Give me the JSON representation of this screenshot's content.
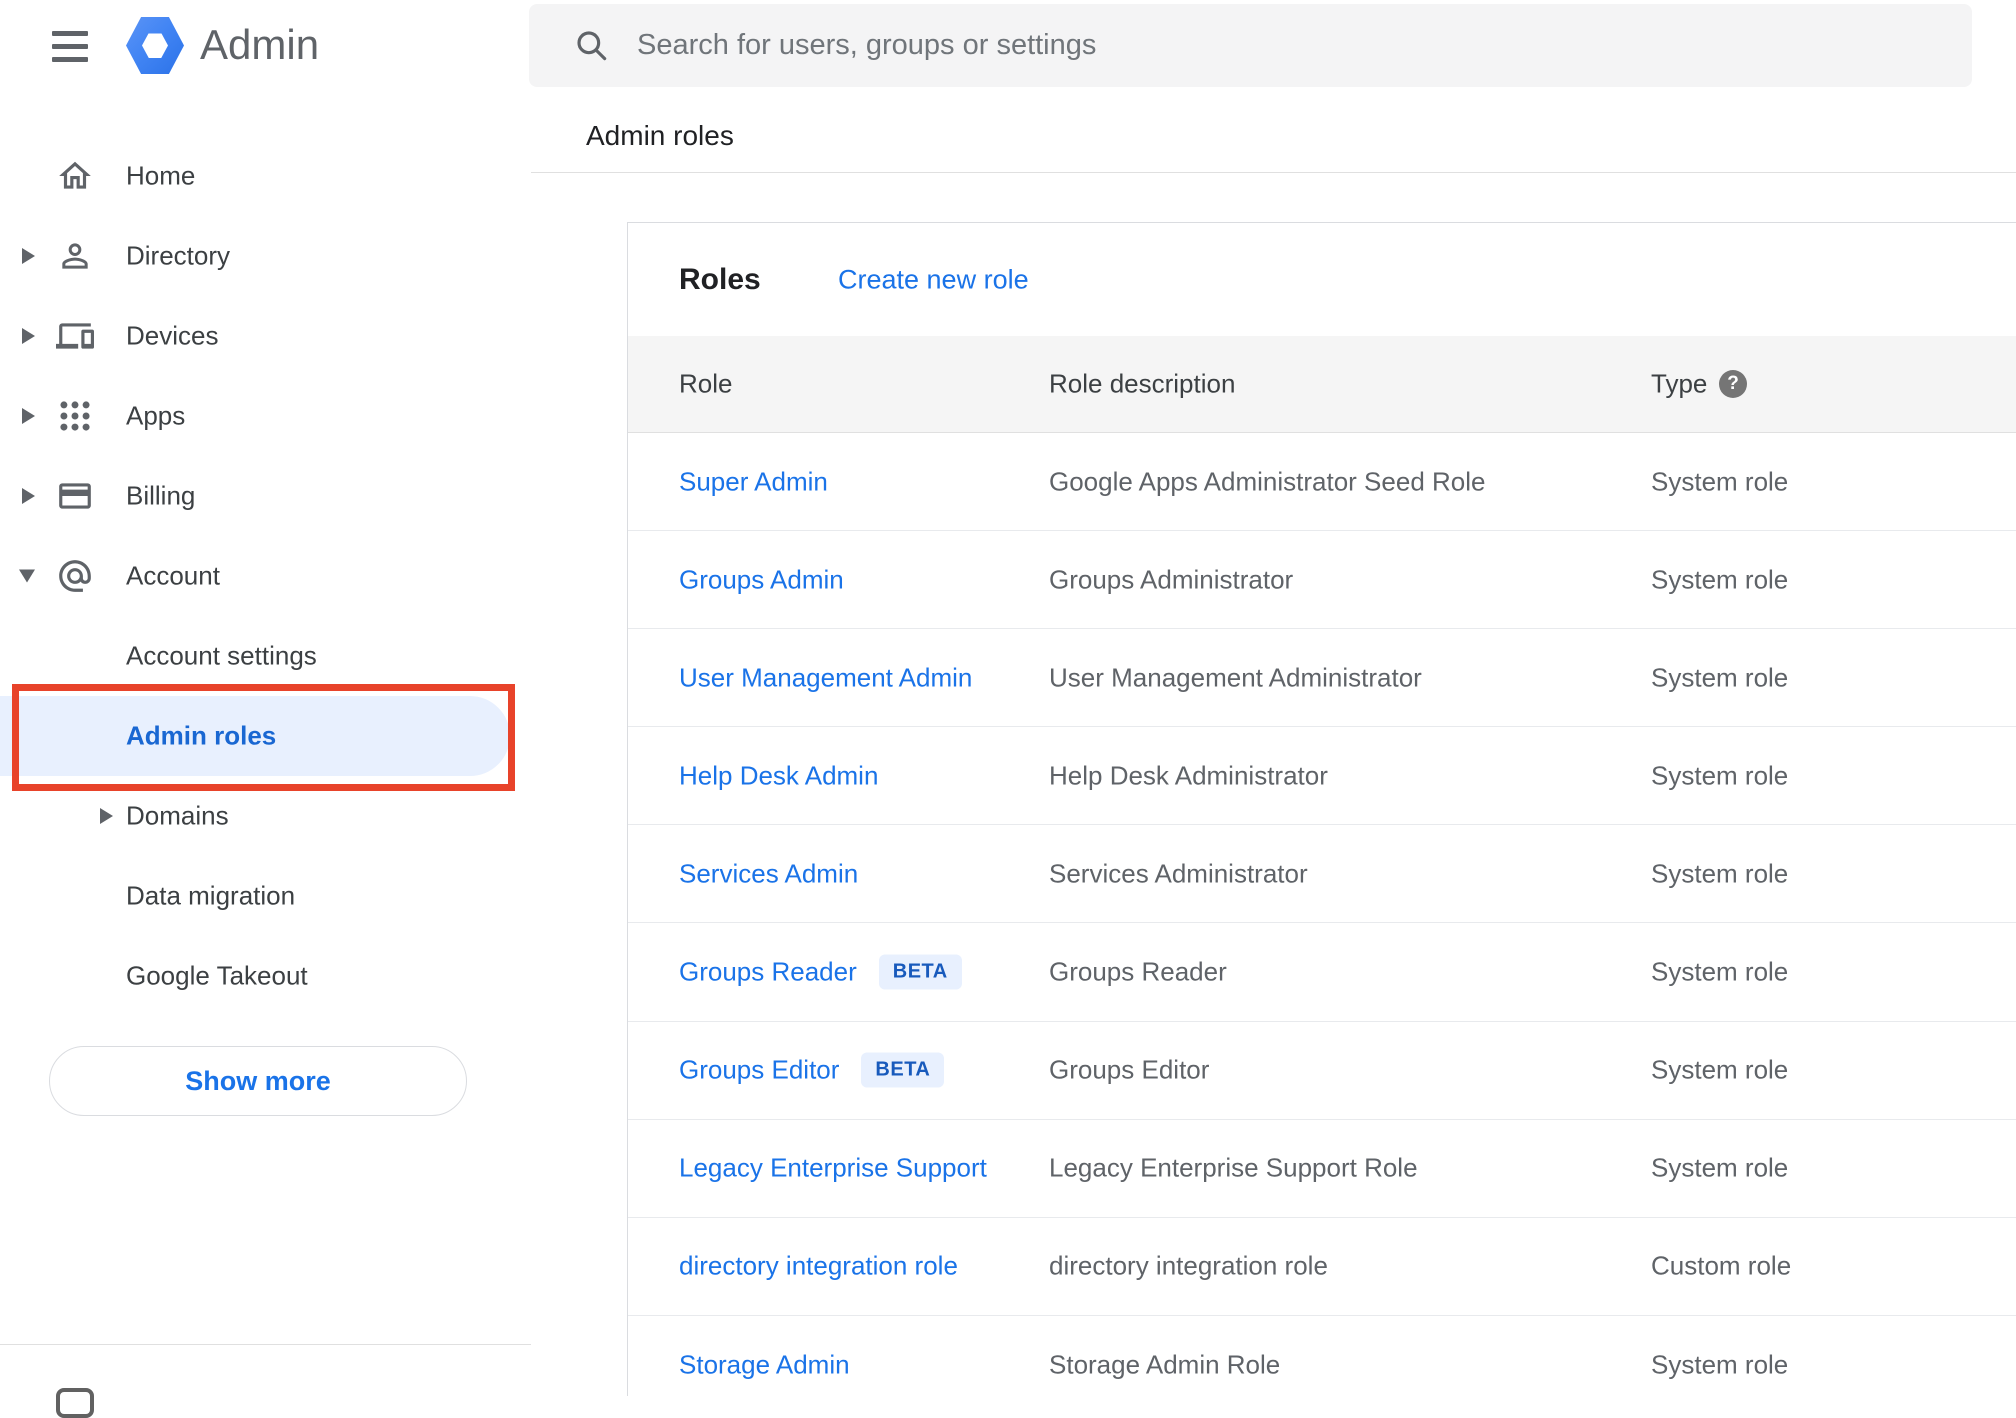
{
  "header": {
    "app_name": "Admin",
    "search_placeholder": "Search for users, groups or settings",
    "breadcrumb": "Admin roles"
  },
  "sidebar": {
    "items": [
      {
        "label": "Home"
      },
      {
        "label": "Directory"
      },
      {
        "label": "Devices"
      },
      {
        "label": "Apps"
      },
      {
        "label": "Billing"
      },
      {
        "label": "Account"
      },
      {
        "label": "Account settings"
      },
      {
        "label": "Admin roles",
        "selected": true
      },
      {
        "label": "Domains"
      },
      {
        "label": "Data migration"
      },
      {
        "label": "Google Takeout"
      }
    ],
    "show_more_label": "Show more"
  },
  "content": {
    "panel_title": "Roles",
    "create_new_role_label": "Create new role",
    "columns": {
      "role": "Role",
      "description": "Role description",
      "type": "Type"
    },
    "rows": [
      {
        "role": "Super Admin",
        "description": "Google Apps Administrator Seed Role",
        "type": "System role"
      },
      {
        "role": "Groups Admin",
        "description": "Groups Administrator",
        "type": "System role"
      },
      {
        "role": "User Management Admin",
        "description": "User Management Administrator",
        "type": "System role"
      },
      {
        "role": "Help Desk Admin",
        "description": "Help Desk Administrator",
        "type": "System role"
      },
      {
        "role": "Services Admin",
        "description": "Services Administrator",
        "type": "System role"
      },
      {
        "role": "Groups Reader",
        "beta_label": "BETA",
        "description": "Groups Reader",
        "type": "System role"
      },
      {
        "role": "Groups Editor",
        "beta_label": "BETA",
        "description": "Groups Editor",
        "type": "System role"
      },
      {
        "role": "Legacy Enterprise Support",
        "description": "Legacy Enterprise Support Role",
        "type": "System role"
      },
      {
        "role": "directory integration role",
        "description": "directory integration role",
        "type": "Custom role"
      },
      {
        "role": "Storage Admin",
        "description": "Storage Admin Role",
        "type": "System role"
      }
    ]
  },
  "colors": {
    "link_blue": "#1a73e8",
    "selected_blue": "#1967d2",
    "annotation_red": "#e8432a",
    "badge_bg": "#e8f0fe",
    "table_header_band": "#f5f5f5",
    "search_bg": "#f4f4f5"
  }
}
